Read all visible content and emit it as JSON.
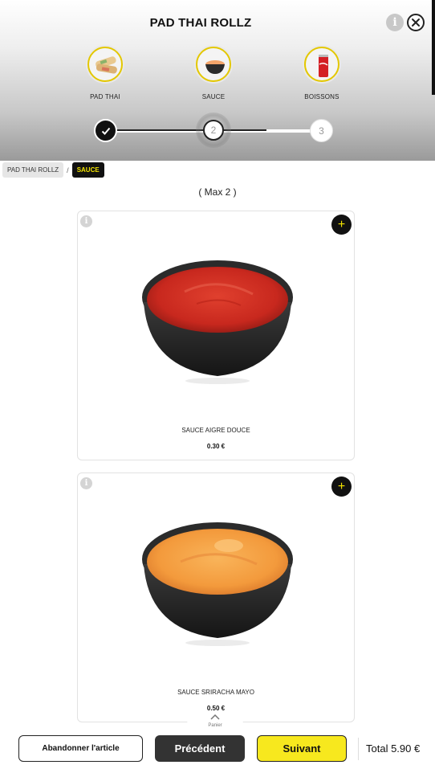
{
  "header": {
    "title": "PAD THAI ROLLZ",
    "steps": [
      {
        "label": "PAD THAI",
        "icon": "spring-rolls-icon"
      },
      {
        "label": "SAUCE",
        "icon": "sauce-bowl-icon"
      },
      {
        "label": "BOISSONS",
        "icon": "soda-can-icon"
      }
    ],
    "progress": {
      "current_step": 2,
      "step2": "2",
      "step3": "3"
    }
  },
  "breadcrumb": {
    "root": "PAD THAI ROLLZ",
    "separator": "/",
    "current": "SAUCE"
  },
  "max_text": "( Max 2 )",
  "products": [
    {
      "name": "SAUCE AIGRE DOUCE",
      "price": "0.30 €",
      "sauce_color": "#c8281e"
    },
    {
      "name": "SAUCE SRIRACHA MAYO",
      "price": "0.50 €",
      "sauce_color": "#f39a3c"
    }
  ],
  "cart_tab": {
    "label": "Panier"
  },
  "footer": {
    "abandon_label": "Abandonner l'article",
    "prev_label": "Précédent",
    "next_label": "Suivant",
    "total": "Total 5.90 €"
  },
  "colors": {
    "accent_yellow": "#f7e81e",
    "dark": "#111111"
  }
}
